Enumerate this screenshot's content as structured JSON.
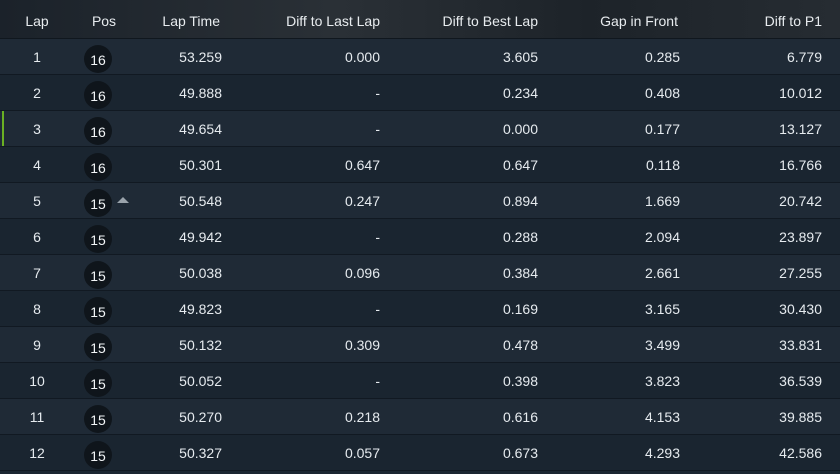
{
  "header": {
    "lap": "Lap",
    "pos": "Pos",
    "lap_time": "Lap Time",
    "diff_last": "Diff to Last Lap",
    "diff_best": "Diff to Best Lap",
    "gap_front": "Gap in Front",
    "diff_p1": "Diff to P1"
  },
  "colors": {
    "highlight": "#6ab023",
    "row_odd": "#1f2a36",
    "row_even": "#1a2530",
    "badge": "#0f151b"
  },
  "rows": [
    {
      "lap": "1",
      "pos": "16",
      "time": "53.259",
      "diff_last": "0.000",
      "diff_best": "3.605",
      "gap": "0.285",
      "p1": "6.779",
      "highlight": false,
      "pos_change": "none"
    },
    {
      "lap": "2",
      "pos": "16",
      "time": "49.888",
      "diff_last": "-",
      "diff_best": "0.234",
      "gap": "0.408",
      "p1": "10.012",
      "highlight": false,
      "pos_change": "none"
    },
    {
      "lap": "3",
      "pos": "16",
      "time": "49.654",
      "diff_last": "-",
      "diff_best": "0.000",
      "gap": "0.177",
      "p1": "13.127",
      "highlight": true,
      "pos_change": "none"
    },
    {
      "lap": "4",
      "pos": "16",
      "time": "50.301",
      "diff_last": "0.647",
      "diff_best": "0.647",
      "gap": "0.118",
      "p1": "16.766",
      "highlight": false,
      "pos_change": "none"
    },
    {
      "lap": "5",
      "pos": "15",
      "time": "50.548",
      "diff_last": "0.247",
      "diff_best": "0.894",
      "gap": "1.669",
      "p1": "20.742",
      "highlight": false,
      "pos_change": "up"
    },
    {
      "lap": "6",
      "pos": "15",
      "time": "49.942",
      "diff_last": "-",
      "diff_best": "0.288",
      "gap": "2.094",
      "p1": "23.897",
      "highlight": false,
      "pos_change": "none"
    },
    {
      "lap": "7",
      "pos": "15",
      "time": "50.038",
      "diff_last": "0.096",
      "diff_best": "0.384",
      "gap": "2.661",
      "p1": "27.255",
      "highlight": false,
      "pos_change": "none"
    },
    {
      "lap": "8",
      "pos": "15",
      "time": "49.823",
      "diff_last": "-",
      "diff_best": "0.169",
      "gap": "3.165",
      "p1": "30.430",
      "highlight": false,
      "pos_change": "none"
    },
    {
      "lap": "9",
      "pos": "15",
      "time": "50.132",
      "diff_last": "0.309",
      "diff_best": "0.478",
      "gap": "3.499",
      "p1": "33.831",
      "highlight": false,
      "pos_change": "none"
    },
    {
      "lap": "10",
      "pos": "15",
      "time": "50.052",
      "diff_last": "-",
      "diff_best": "0.398",
      "gap": "3.823",
      "p1": "36.539",
      "highlight": false,
      "pos_change": "none"
    },
    {
      "lap": "11",
      "pos": "15",
      "time": "50.270",
      "diff_last": "0.218",
      "diff_best": "0.616",
      "gap": "4.153",
      "p1": "39.885",
      "highlight": false,
      "pos_change": "none"
    },
    {
      "lap": "12",
      "pos": "15",
      "time": "50.327",
      "diff_last": "0.057",
      "diff_best": "0.673",
      "gap": "4.293",
      "p1": "42.586",
      "highlight": false,
      "pos_change": "none"
    }
  ]
}
